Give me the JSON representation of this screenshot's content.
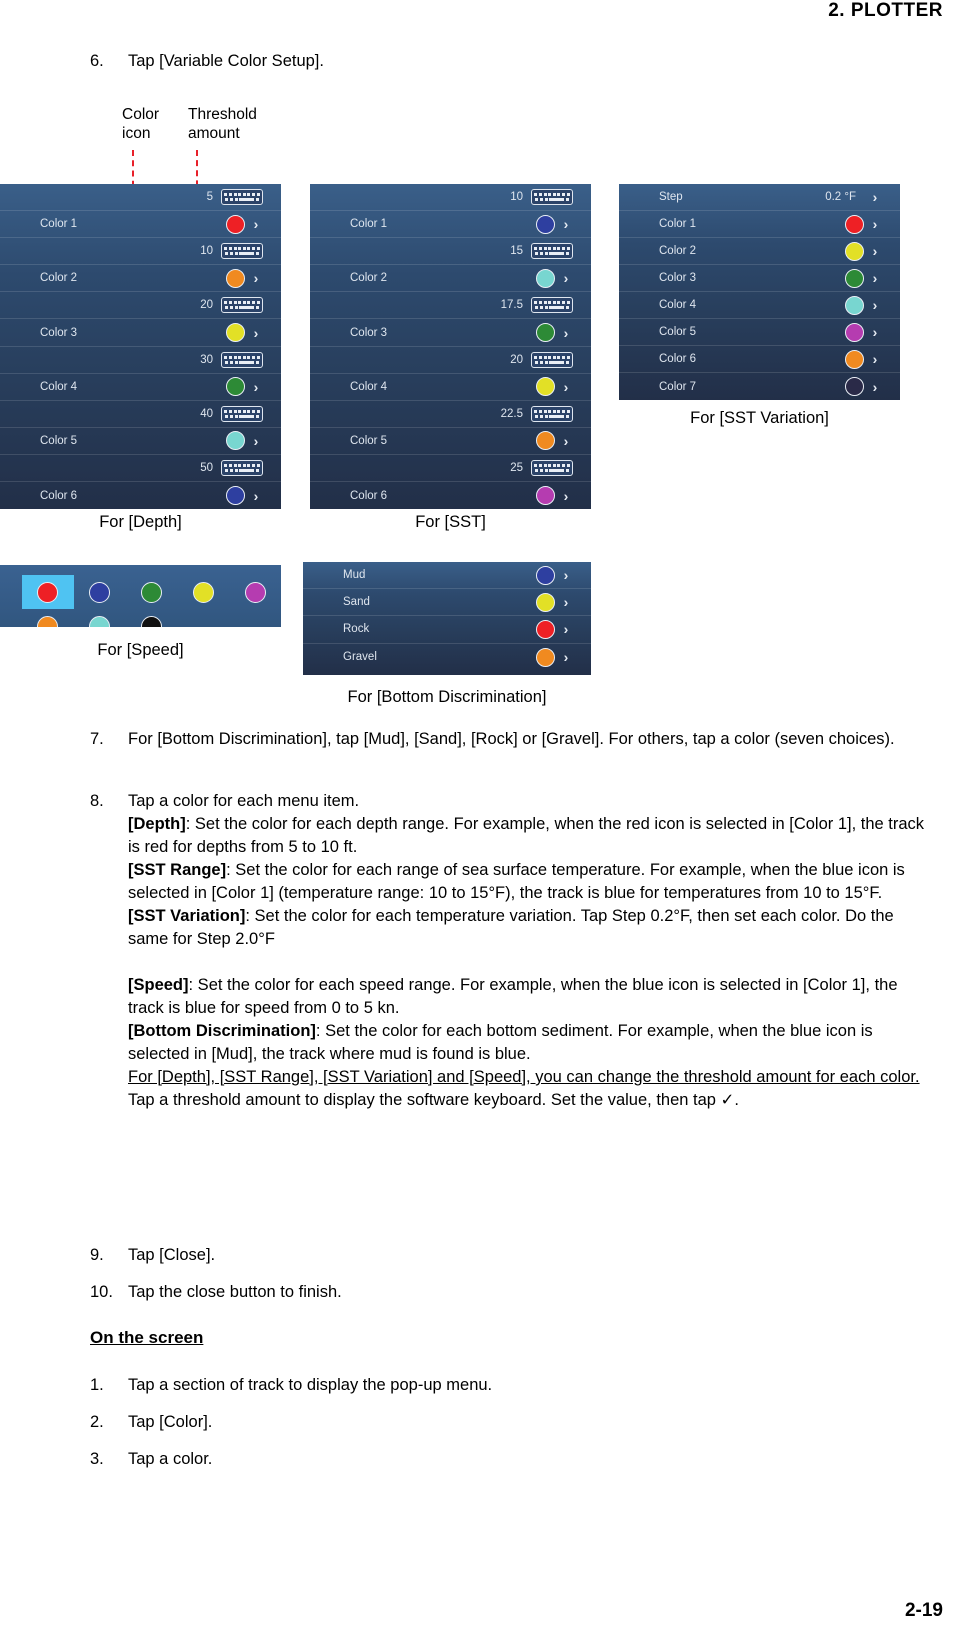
{
  "header": {
    "chapter": "2.  PLOTTER"
  },
  "page_number": "2-19",
  "callouts": {
    "color_icon": "Color\nicon",
    "color_icon_l1": "Color",
    "color_icon_l2": "icon",
    "threshold_l1": "Threshold",
    "threshold_l2": "amount"
  },
  "captions": {
    "depth": "For [Depth]",
    "sst": "For [SST]",
    "sst_variation": "For [SST Variation]",
    "speed": "For [Speed]",
    "bottom_discrimination": "For [Bottom Discrimination]"
  },
  "panels": {
    "depth": {
      "rows": [
        {
          "type": "threshold",
          "value": "5",
          "icon": "keyboard-icon"
        },
        {
          "type": "color",
          "label": "Color 1",
          "color": "#ee2025",
          "chevron": "›"
        },
        {
          "type": "threshold",
          "value": "10",
          "icon": "keyboard-icon"
        },
        {
          "type": "color",
          "label": "Color 2",
          "color": "#f08a20",
          "chevron": "›"
        },
        {
          "type": "threshold",
          "value": "20",
          "icon": "keyboard-icon"
        },
        {
          "type": "color",
          "label": "Color 3",
          "color": "#e2e026",
          "chevron": "›"
        },
        {
          "type": "threshold",
          "value": "30",
          "icon": "keyboard-icon"
        },
        {
          "type": "color",
          "label": "Color 4",
          "color": "#2d8a36",
          "chevron": "›"
        },
        {
          "type": "threshold",
          "value": "40",
          "icon": "keyboard-icon"
        },
        {
          "type": "color",
          "label": "Color 5",
          "color": "#78d6d0",
          "chevron": "›"
        },
        {
          "type": "threshold",
          "value": "50",
          "icon": "keyboard-icon"
        },
        {
          "type": "color",
          "label": "Color 6",
          "color": "#2e3fa0",
          "chevron": "›"
        }
      ]
    },
    "sst": {
      "rows": [
        {
          "type": "threshold",
          "value": "10",
          "icon": "keyboard-icon"
        },
        {
          "type": "color",
          "label": "Color 1",
          "color": "#2e3fa0",
          "chevron": "›"
        },
        {
          "type": "threshold",
          "value": "15",
          "icon": "keyboard-icon"
        },
        {
          "type": "color",
          "label": "Color 2",
          "color": "#78d6d0",
          "chevron": "›"
        },
        {
          "type": "threshold",
          "value": "17.5",
          "icon": "keyboard-icon"
        },
        {
          "type": "color",
          "label": "Color 3",
          "color": "#2d8a36",
          "chevron": "›"
        },
        {
          "type": "threshold",
          "value": "20",
          "icon": "keyboard-icon"
        },
        {
          "type": "color",
          "label": "Color 4",
          "color": "#e2e026",
          "chevron": "›"
        },
        {
          "type": "threshold",
          "value": "22.5",
          "icon": "keyboard-icon"
        },
        {
          "type": "color",
          "label": "Color 5",
          "color": "#f08a20",
          "chevron": "›"
        },
        {
          "type": "threshold",
          "value": "25",
          "icon": "keyboard-icon"
        },
        {
          "type": "color",
          "label": "Color 6",
          "color": "#b53cb0",
          "chevron": "›"
        }
      ]
    },
    "sst_variation": {
      "rows": [
        {
          "type": "value",
          "label": "Step",
          "value": "0.2 °F",
          "chevron": "›"
        },
        {
          "type": "color",
          "label": "Color 1",
          "color": "#ee2025",
          "chevron": "›"
        },
        {
          "type": "color",
          "label": "Color 2",
          "color": "#e2e026",
          "chevron": "›"
        },
        {
          "type": "color",
          "label": "Color 3",
          "color": "#2d8a36",
          "chevron": "›"
        },
        {
          "type": "color",
          "label": "Color 4",
          "color": "#78d6d0",
          "chevron": "›"
        },
        {
          "type": "color",
          "label": "Color 5",
          "color": "#b53cb0",
          "chevron": "›"
        },
        {
          "type": "color",
          "label": "Color 6",
          "color": "#f08a20",
          "chevron": "›"
        },
        {
          "type": "color",
          "label": "Color 7",
          "color": "#2a2a48",
          "chevron": "›"
        }
      ]
    },
    "speed": {
      "swatches": [
        [
          {
            "color": "#ee2025",
            "selected": true
          },
          {
            "color": "#2e3fa0",
            "selected": false
          },
          {
            "color": "#2d8a36",
            "selected": false
          },
          {
            "color": "#e2e026",
            "selected": false
          },
          {
            "color": "#b53cb0",
            "selected": false
          }
        ],
        [
          {
            "color": "#f08a20",
            "selected": false
          },
          {
            "color": "#78d6d0",
            "selected": false
          },
          {
            "color": "#111111",
            "selected": false
          },
          {
            "color": "",
            "selected": false
          },
          {
            "color": "",
            "selected": false
          }
        ]
      ]
    },
    "bottom_discrimination": {
      "rows": [
        {
          "type": "color",
          "label": "Mud",
          "color": "#2e3fa0",
          "chevron": "›"
        },
        {
          "type": "color",
          "label": "Sand",
          "color": "#e2e026",
          "chevron": "›"
        },
        {
          "type": "color",
          "label": "Rock",
          "color": "#ee2025",
          "chevron": "›"
        },
        {
          "type": "color",
          "label": "Gravel",
          "color": "#f08a20",
          "chevron": "›"
        }
      ]
    }
  },
  "steps": {
    "s6_num": "6.",
    "s6_text": "Tap [Variable Color Setup].",
    "s7_num": "7.",
    "s7_text": "For [Bottom Discrimination], tap [Mud], [Sand], [Rock] or [Gravel]. For others, tap a color (seven choices).",
    "s8_num": "8.",
    "s8_line1": "Tap a color for each menu item.",
    "s8_depth_label": "[Depth]",
    "s8_depth_text": ": Set the color for each depth range. For example, when the red icon is selected in [Color 1], the track is red for depths from 5 to 10 ft.",
    "s8_sstrange_label": "[SST Range]",
    "s8_sstrange_text": ": Set the color for each range of sea surface temperature. For example, when the blue icon is selected in [Color 1] (temperature range: 10 to 15°F), the track is blue for temperatures from 10 to 15°F.",
    "s8_sstvar_label": "[SST Variation]",
    "s8_sstvar_text": ": Set the color for each temperature variation. Tap Step 0.2°F, then set each color. Do the same for Step 2.0°F",
    "s8_speed_label": "[Speed]",
    "s8_speed_text": ": Set the color for each speed range. For example, when the blue icon is selected in [Color 1], the track is blue for speed from 0 to 5 kn.",
    "s8_bottom_label": "[Bottom Discrimination]",
    "s8_bottom_text": ": Set the color for each bottom sediment. For example, when the blue icon is selected in [Mud], the track where mud is found is blue.",
    "s8_underlined": "For [Depth], [SST Range], [SST Variation] and [Speed], you can change the threshold amount for each color.",
    "s8_tail": " Tap a threshold amount to display the software keyboard. Set the value, then tap ✓.",
    "s9_num": "9.",
    "s9_text": "Tap [Close].",
    "s10_num": "10.",
    "s10_text": "Tap the close button to finish."
  },
  "on_the_screen": {
    "heading": "On the screen",
    "items": [
      {
        "num": "1.",
        "text": "Tap a section of track to display the pop-up menu."
      },
      {
        "num": "2.",
        "text": "Tap [Color]."
      },
      {
        "num": "3.",
        "text": "Tap a color."
      }
    ]
  }
}
